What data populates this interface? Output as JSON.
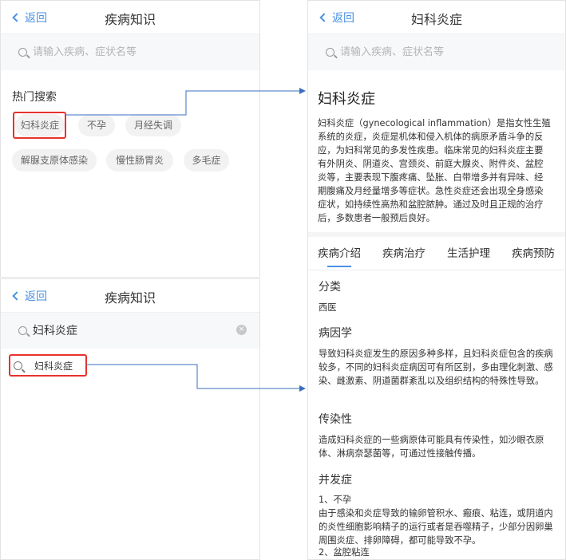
{
  "screen_home": {
    "back_label": "返回",
    "title": "疾病知识",
    "search_placeholder": "请输入疾病、症状名等",
    "hot_title": "热门搜索",
    "hot_tags": [
      "妇科炎症",
      "不孕",
      "月经失调",
      "解脲支原体感染",
      "慢性肠胃炎",
      "多毛症"
    ]
  },
  "screen_search": {
    "back_label": "返回",
    "title": "疾病知识",
    "search_value": "妇科炎症",
    "clear_icon": "×",
    "suggestion": "妇科炎症"
  },
  "screen_detail": {
    "back_label": "返回",
    "title": "妇科炎症",
    "search_placeholder": "请输入疾病、症状名等",
    "article_title": "妇科炎症",
    "intro": "妇科炎症（gynecological inflammation）是指女性生殖系统的炎症，炎症是机体和侵入机体的病原矛盾斗争的反应，为妇科常见的多发性疾患。临床常见的妇科炎症主要有外阴炎、阴道炎、宫颈炎、前庭大腺炎、附件炎、盆腔炎等，主要表现下腹疼痛、坠胀、白带增多并有异味、经期腹痛及月经量增多等症状。急性炎症还会出现全身感染症状，如持续性高热和盆腔脓肿。通过及时且正规的治疗后，多数患者一般预后良好。",
    "tabs": [
      "疾病介绍",
      "疾病治疗",
      "生活护理",
      "疾病预防"
    ],
    "sections": {
      "category": {
        "heading": "分类",
        "text": "西医"
      },
      "etiology": {
        "heading": "病因学",
        "text": "导致妇科炎症发生的原因多种多样，且妇科炎症包含的疾病较多，不同的妇科炎症病因可有所区别，多由理化刺激、感染、雌激素、阴道菌群紊乱以及组织结构的特殊性导致。"
      },
      "contagion": {
        "heading": "传染性",
        "text": "造成妇科炎症的一些病原体可能具有传染性，如沙眼衣原体、淋病奈瑟菌等，可通过性接触传播。"
      },
      "complication": {
        "heading": "并发症",
        "item1_title": "1、不孕",
        "item1_text": "由于感染和炎症导致的输卵管积水、瘢痕、粘连，或阴道内的炎性细胞影响精子的运行或者是吞噬精子，少部分因卵巢周围炎症、排卵障碍，都可能导致不孕。",
        "item2_title": "2、盆腔粘连"
      }
    }
  },
  "colors": {
    "accent": "#4a90e2",
    "highlight_box": "#e8322d",
    "connector": "#3a6fc0"
  }
}
